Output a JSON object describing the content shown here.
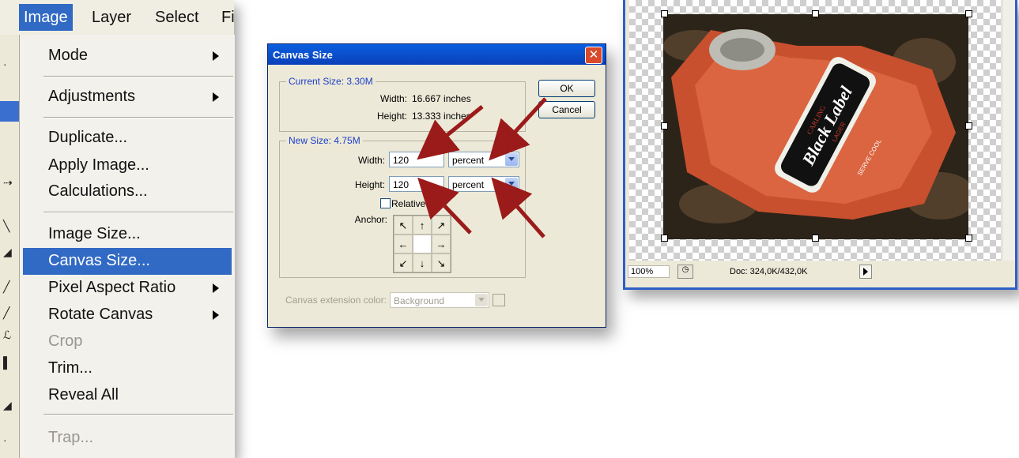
{
  "menubar": {
    "items": [
      "Image",
      "Layer",
      "Select",
      "Fi"
    ]
  },
  "image_menu": {
    "items": [
      {
        "label": "Mode",
        "submenu": true
      },
      {
        "label": "Adjustments",
        "submenu": true
      },
      {
        "label": "Duplicate..."
      },
      {
        "label": "Apply Image..."
      },
      {
        "label": "Calculations..."
      },
      {
        "label": "Image Size..."
      },
      {
        "label": "Canvas Size...",
        "selected": true
      },
      {
        "label": "Pixel Aspect Ratio",
        "submenu": true
      },
      {
        "label": "Rotate Canvas",
        "submenu": true
      },
      {
        "label": "Crop",
        "disabled": true
      },
      {
        "label": "Trim..."
      },
      {
        "label": "Reveal All"
      },
      {
        "label": "Trap...",
        "disabled": true
      }
    ]
  },
  "dialog": {
    "title": "Canvas Size",
    "current_size": {
      "title": "Current Size: 3.30M",
      "width_label": "Width:",
      "width_value": "16.667 inches",
      "height_label": "Height:",
      "height_value": "13.333 inches"
    },
    "new_size": {
      "title": "New Size: 4.75M",
      "width_label": "Width:",
      "width_value": "120",
      "width_unit": "percent",
      "height_label": "Height:",
      "height_value": "120",
      "height_unit": "percent",
      "relative_label": "Relative",
      "anchor_label": "Anchor:"
    },
    "ok_label": "OK",
    "cancel_label": "Cancel",
    "extension_label": "Canvas extension color:",
    "extension_value": "Background",
    "arrow_color": "#9b1b1b"
  },
  "image_window": {
    "zoom": "100%",
    "doc": "Doc: 324,0K/432,0K",
    "can_text": {
      "brand": "CARLING",
      "name": "Black Label",
      "type": "LAGER",
      "slogan": "SERVE COOL"
    }
  }
}
